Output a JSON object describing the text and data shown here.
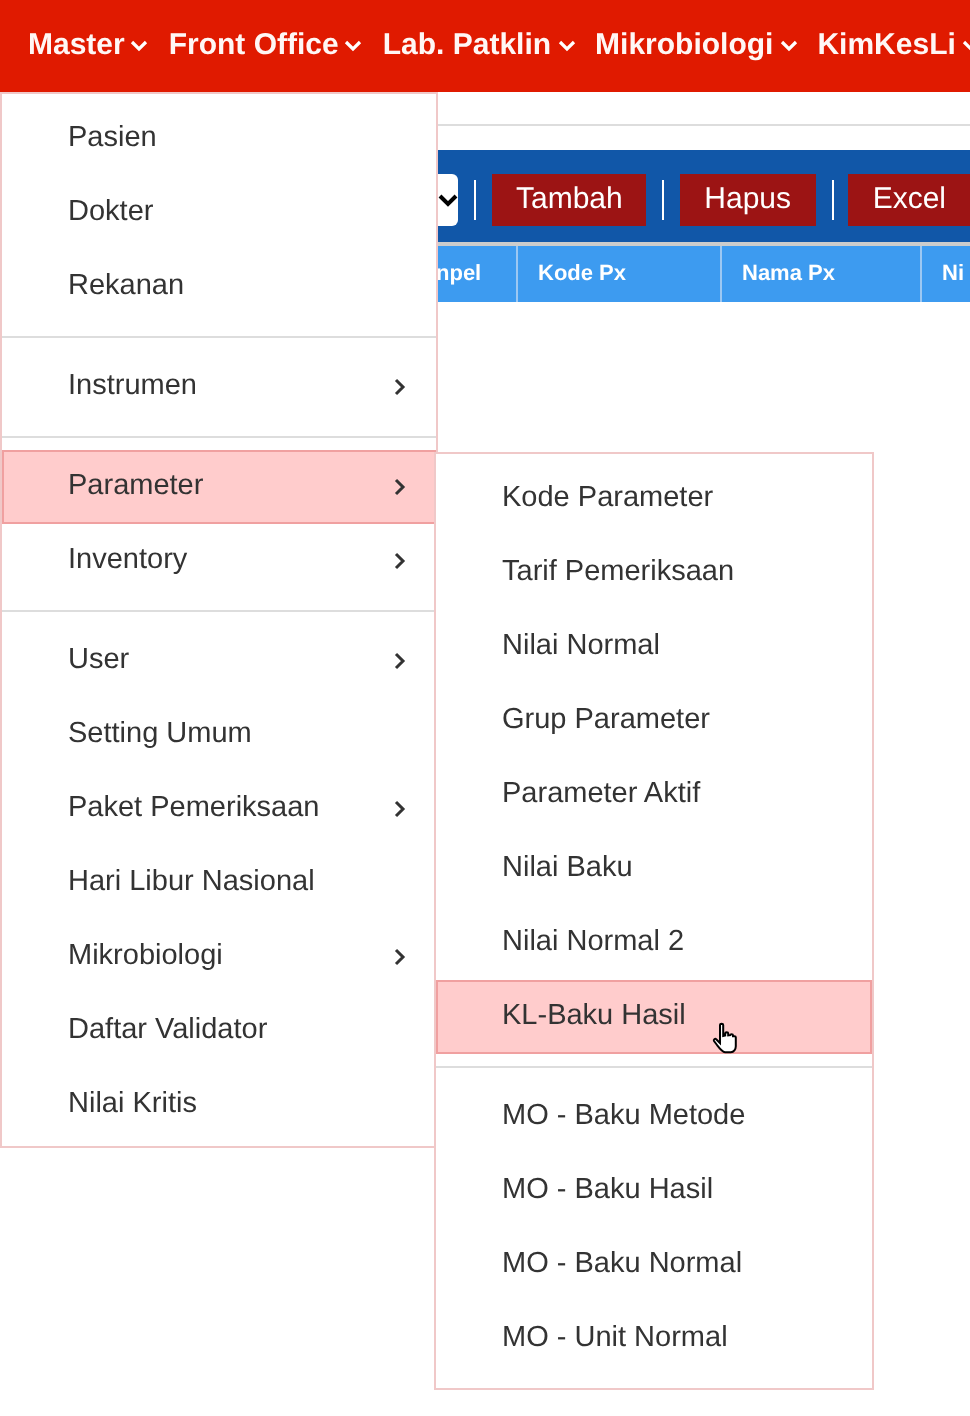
{
  "navbar": [
    {
      "label": "Master"
    },
    {
      "label": "Front Office"
    },
    {
      "label": "Lab. Patklin"
    },
    {
      "label": "Mikrobiologi"
    },
    {
      "label": "KimKesLi"
    }
  ],
  "toolbar": {
    "buttons": [
      "Tambah",
      "Hapus",
      "Excel"
    ]
  },
  "table": {
    "columns": [
      "npel",
      "Kode Px",
      "Nama Px",
      "Ni"
    ]
  },
  "menu": {
    "groups": [
      [
        {
          "label": "Pasien",
          "submenu": false,
          "selected": false
        },
        {
          "label": "Dokter",
          "submenu": false,
          "selected": false
        },
        {
          "label": "Rekanan",
          "submenu": false,
          "selected": false
        }
      ],
      [
        {
          "label": "Instrumen",
          "submenu": true,
          "selected": false
        }
      ],
      [
        {
          "label": "Parameter",
          "submenu": true,
          "selected": true
        },
        {
          "label": "Inventory",
          "submenu": true,
          "selected": false
        }
      ],
      [
        {
          "label": "User",
          "submenu": true,
          "selected": false
        },
        {
          "label": "Setting Umum",
          "submenu": false,
          "selected": false
        },
        {
          "label": "Paket Pemeriksaan",
          "submenu": true,
          "selected": false
        },
        {
          "label": "Hari Libur Nasional",
          "submenu": false,
          "selected": false
        },
        {
          "label": "Mikrobiologi",
          "submenu": true,
          "selected": false
        },
        {
          "label": "Daftar Validator",
          "submenu": false,
          "selected": false
        },
        {
          "label": "Nilai Kritis",
          "submenu": false,
          "selected": false
        }
      ]
    ]
  },
  "submenu": {
    "groups": [
      [
        {
          "label": "Kode Parameter",
          "selected": false
        },
        {
          "label": "Tarif Pemeriksaan",
          "selected": false
        },
        {
          "label": "Nilai Normal",
          "selected": false
        },
        {
          "label": "Grup Parameter",
          "selected": false
        },
        {
          "label": "Parameter Aktif",
          "selected": false
        },
        {
          "label": "Nilai Baku",
          "selected": false
        },
        {
          "label": "Nilai Normal 2",
          "selected": false
        },
        {
          "label": "KL-Baku Hasil",
          "selected": true
        }
      ],
      [
        {
          "label": "MO - Baku Metode",
          "selected": false
        },
        {
          "label": "MO - Baku Hasil",
          "selected": false
        },
        {
          "label": "MO - Baku Normal",
          "selected": false
        },
        {
          "label": "MO - Unit Normal",
          "selected": false
        }
      ]
    ]
  }
}
